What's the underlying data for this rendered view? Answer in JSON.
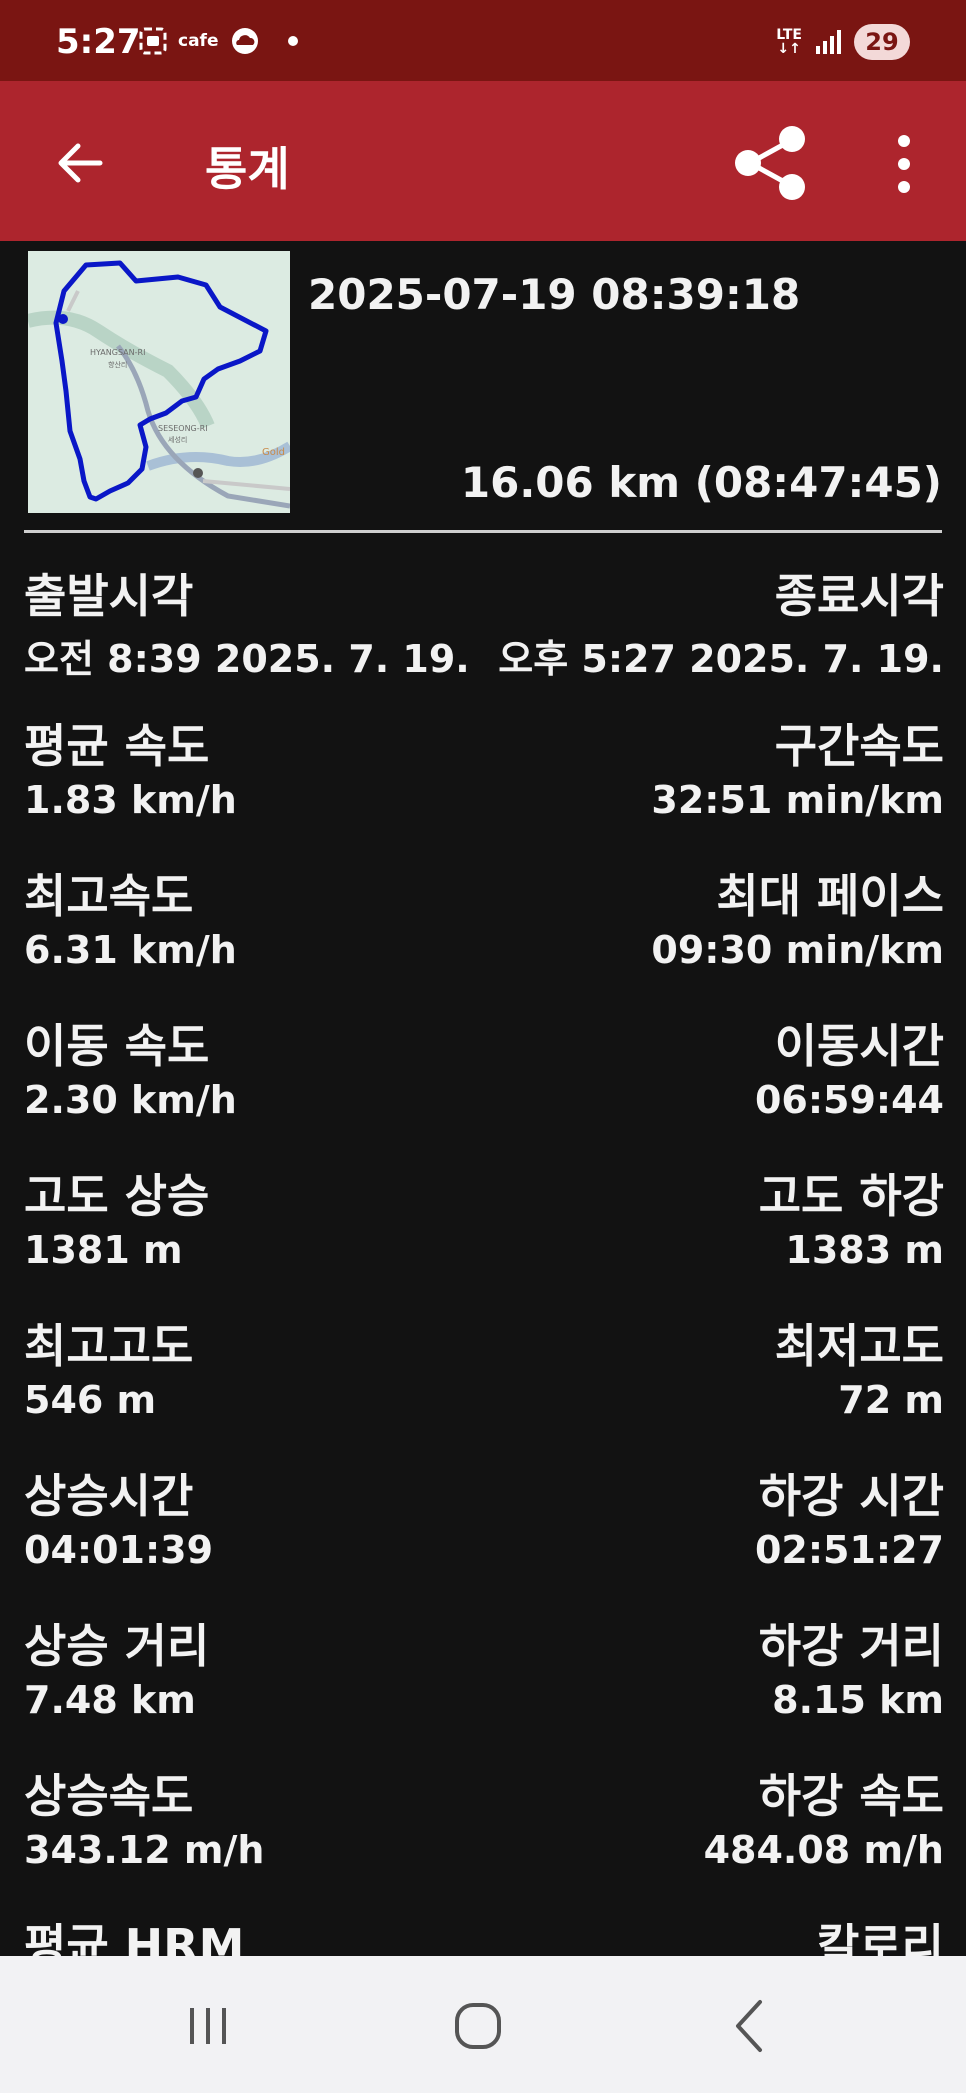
{
  "status_bar": {
    "time": "5:27",
    "cafe_label": "cafe",
    "network": "LTE",
    "battery": "29"
  },
  "app_bar": {
    "title": "통계"
  },
  "trip": {
    "date": "2025-07-19 08:39:18",
    "summary": "16.06 km (08:47:45)",
    "map_labels": {
      "area1": "HYANGSAN-RI",
      "area1_kr": "향산리",
      "area2": "SESEONG-RI",
      "area2_kr": "세성리",
      "edge": "Gold"
    }
  },
  "stats": [
    {
      "left_label": "출발시각",
      "left_value": "오전 8:39 2025. 7. 19.",
      "right_label": "종료시각",
      "right_value": "오후 5:27 2025. 7. 19."
    },
    {
      "left_label": "평균 속도",
      "left_value": "1.83 km/h",
      "right_label": "구간속도",
      "right_value": "32:51 min/km"
    },
    {
      "left_label": "최고속도",
      "left_value": "6.31 km/h",
      "right_label": "최대 페이스",
      "right_value": "09:30 min/km"
    },
    {
      "left_label": "이동 속도",
      "left_value": "2.30 km/h",
      "right_label": "이동시간",
      "right_value": "06:59:44"
    },
    {
      "left_label": "고도 상승",
      "left_value": "1381 m",
      "right_label": "고도 하강",
      "right_value": "1383 m"
    },
    {
      "left_label": "최고고도",
      "left_value": "546 m",
      "right_label": "최저고도",
      "right_value": "72 m"
    },
    {
      "left_label": "상승시간",
      "left_value": "04:01:39",
      "right_label": "하강 시간",
      "right_value": "02:51:27"
    },
    {
      "left_label": "상승 거리",
      "left_value": "7.48 km",
      "right_label": "하강 거리",
      "right_value": "8.15 km"
    },
    {
      "left_label": "상승속도",
      "left_value": "343.12 m/h",
      "right_label": "하강 속도",
      "right_value": "484.08 m/h"
    },
    {
      "left_label": "평균 HRM",
      "left_value": "",
      "right_label": "칼로리",
      "right_value": ""
    }
  ],
  "colors": {
    "status_bar": "#7a1512",
    "app_bar": "#ad252d",
    "background": "#121212",
    "route": "#0a17c7"
  }
}
